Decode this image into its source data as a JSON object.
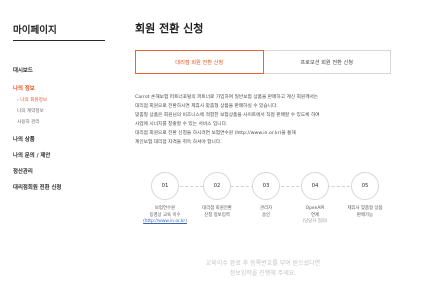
{
  "sidebar": {
    "title": "마이페이지",
    "items": [
      {
        "label": "대시보드"
      },
      {
        "label": "나의 정보"
      },
      {
        "label": "나의 상품"
      },
      {
        "label": "나의 문의 / 제안"
      },
      {
        "label": "정산관리"
      },
      {
        "label": "대리점회원 전환 신청"
      }
    ],
    "subitems": [
      {
        "label": "› 나의 회원정보"
      },
      {
        "label": "나의 계약정보"
      },
      {
        "label": "사용자 관리"
      }
    ]
  },
  "main": {
    "title": "회원 전환 신청",
    "tabs": [
      {
        "label": "대리점 회원 전환 신청"
      },
      {
        "label": "프로모션 회원 전환 신청"
      }
    ],
    "description": [
      "Carrot 손해보험 퍼트너포털의 퍼트너로 가입하여 일반보험 상품을 판매하고 계신 회원께서는",
      "대리점 회원으로 전환하시면 제휴사 맞춤형 상품을 판매하실 수 있습니다.",
      "맞춤형 상품은 회원님의 비즈니스에 적합한 보험상품을 사이트에서 직접 판매할 수 있도록 하여",
      "사업에 시너지를 창출할 수 있는 서비스 입니다.",
      "대리점 회원으로 전환 신청을 하시려면 보험연수원 (http://www.in.or.kr)을 통해",
      "계인보험 대리점 자격을 취득 하셔야 합니다."
    ],
    "steps": [
      {
        "number": "01",
        "line1": "보험연수원",
        "line2": "등영상 교육 이수",
        "line3": "(http://www.in.or.kr)"
      },
      {
        "number": "02",
        "line1": "대리점 회원전환",
        "line2": "신청 정보입력",
        "line3": ""
      },
      {
        "number": "03",
        "line1": "관리자",
        "line2": "승인",
        "line3": ""
      },
      {
        "number": "04",
        "line1": "OpenAPI",
        "line2": "연계",
        "line3": "(당당자 협의)"
      },
      {
        "number": "05",
        "line1": "제휴사 맞춤형 상품",
        "line2": "판매가능",
        "line3": ""
      }
    ],
    "notice": [
      "교육이수 완료 후 등록번호를 부여 받으셨다면",
      "정보입력을 진행해 주세요."
    ]
  },
  "colors": {
    "accent": "#e4531d",
    "link": "#3a64b3"
  }
}
